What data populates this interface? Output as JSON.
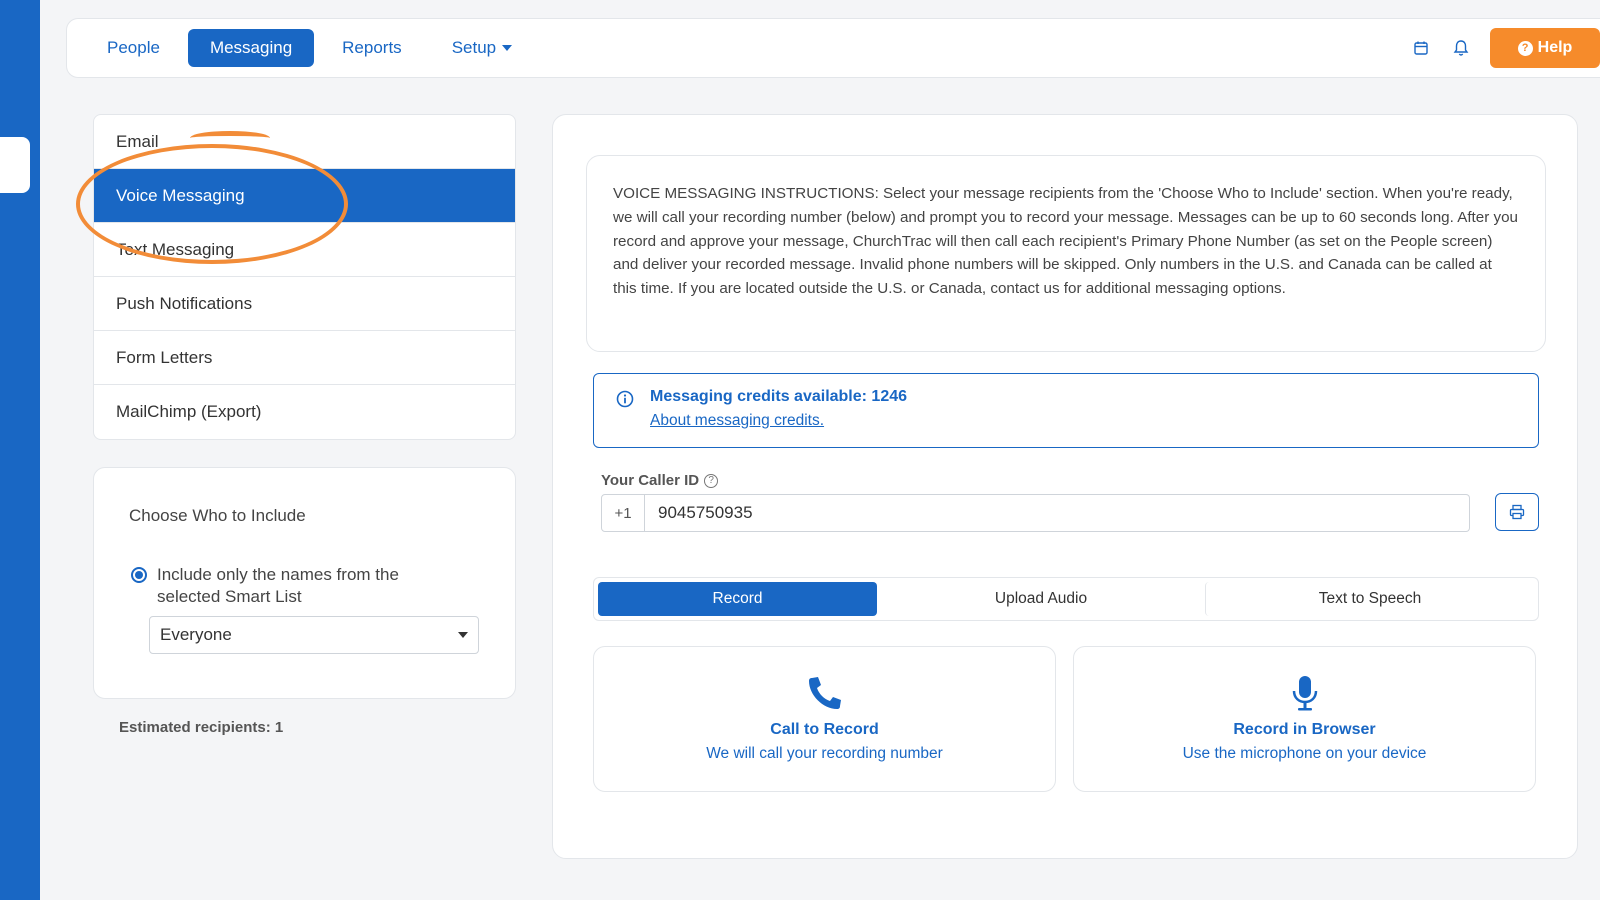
{
  "nav": {
    "items": [
      {
        "label": "People"
      },
      {
        "label": "Messaging"
      },
      {
        "label": "Reports"
      },
      {
        "label": "Setup"
      }
    ],
    "help_label": "Help"
  },
  "side_menu": {
    "items": [
      {
        "label": "Email"
      },
      {
        "label": "Voice Messaging"
      },
      {
        "label": "Text Messaging"
      },
      {
        "label": "Push Notifications"
      },
      {
        "label": "Form Letters"
      },
      {
        "label": "MailChimp (Export)"
      }
    ]
  },
  "choose": {
    "title": "Choose Who to Include",
    "radio_label": "Include only the names from the selected Smart List",
    "select_value": "Everyone"
  },
  "estimated": "Estimated recipients: 1",
  "instructions": "VOICE MESSAGING INSTRUCTIONS: Select your message recipients from the 'Choose Who to Include' section. When you're ready, we will call your recording number (below) and prompt you to record your message. Messages can be up to 60 seconds long. After you record and approve your message, ChurchTrac will then call each recipient's Primary Phone Number (as set on the People screen) and deliver your recorded message. Invalid phone numbers will be skipped. Only numbers in the U.S. and Canada can be called at this time. If you are located outside the U.S. or Canada, contact us for additional messaging options.",
  "credits": {
    "text": "Messaging credits available: 1246",
    "link": "About messaging credits."
  },
  "caller": {
    "label": "Your Caller ID",
    "prefix": "+1",
    "value": "9045750935"
  },
  "tabs": [
    {
      "label": "Record"
    },
    {
      "label": "Upload Audio"
    },
    {
      "label": "Text to Speech"
    }
  ],
  "options": [
    {
      "title": "Call to Record",
      "sub": "We will call your recording number"
    },
    {
      "title": "Record in Browser",
      "sub": "Use the microphone on your device"
    }
  ],
  "colors": {
    "primary": "#1967c4",
    "accent": "#f68b2b",
    "annotation": "#f28c38"
  }
}
